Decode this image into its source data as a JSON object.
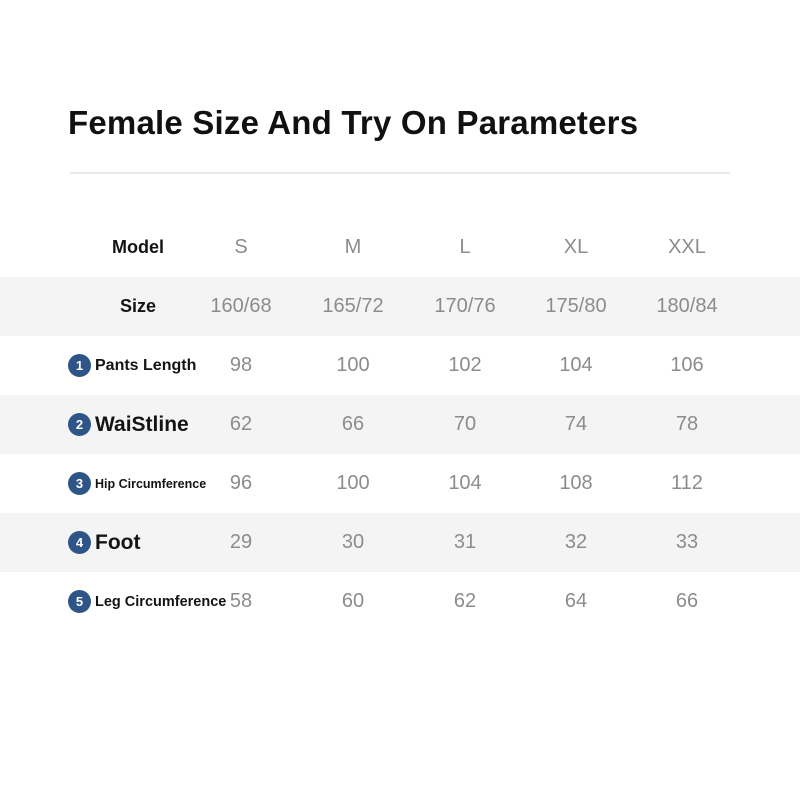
{
  "title": "Female Size And Try On Parameters",
  "table": {
    "header": {
      "label": "Model",
      "sizes": [
        "S",
        "M",
        "L",
        "XL",
        "XXL"
      ]
    },
    "size_row": {
      "label": "Size",
      "values": [
        "160/68",
        "165/72",
        "170/76",
        "175/80",
        "180/84"
      ]
    },
    "rows": [
      {
        "index": "1",
        "label": "Pants Length",
        "values": [
          "98",
          "100",
          "102",
          "104",
          "106"
        ]
      },
      {
        "index": "2",
        "label": "WaiStline",
        "values": [
          "62",
          "66",
          "70",
          "74",
          "78"
        ]
      },
      {
        "index": "3",
        "label": "Hip Circumference",
        "values": [
          "96",
          "100",
          "104",
          "108",
          "112"
        ]
      },
      {
        "index": "4",
        "label": "Foot",
        "values": [
          "29",
          "30",
          "31",
          "32",
          "33"
        ]
      },
      {
        "index": "5",
        "label": "Leg Circumference",
        "values": [
          "58",
          "60",
          "62",
          "64",
          "66"
        ]
      }
    ]
  },
  "colors": {
    "badge": "#2f5487",
    "band": "#f4f4f4",
    "value_text": "#8c8c8c",
    "label_text": "#141414"
  }
}
